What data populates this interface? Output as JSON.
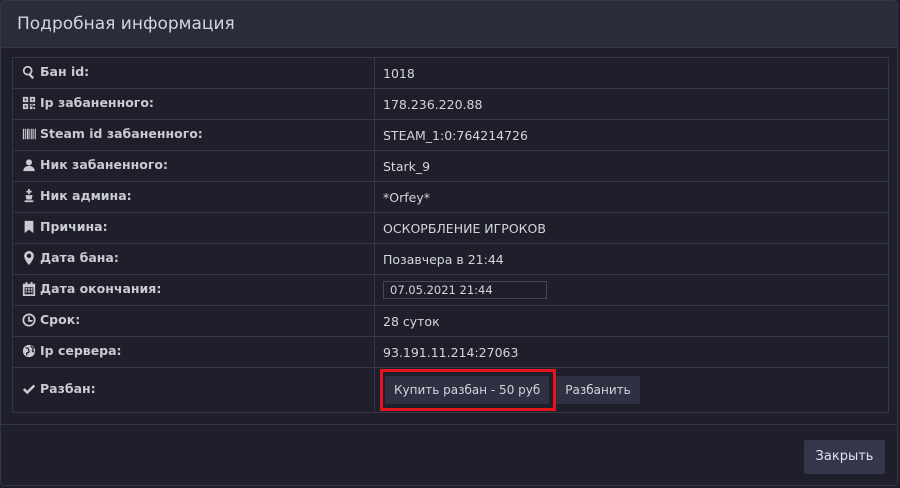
{
  "modal": {
    "title": "Подробная информация"
  },
  "rows": [
    {
      "label": "Бан id:",
      "value": "1018",
      "icon": "search-icon"
    },
    {
      "label": "Ip забаненного:",
      "value": "178.236.220.88",
      "icon": "qr-code-icon"
    },
    {
      "label": "Steam id забаненного:",
      "value": "STEAM_1:0:764214726",
      "icon": "barcode-icon"
    },
    {
      "label": "Ник забаненного:",
      "value": "Stark_9",
      "icon": "user-icon"
    },
    {
      "label": "Ник админа:",
      "value": "*Orfey*",
      "icon": "chess-king-icon"
    },
    {
      "label": "Причина:",
      "value": "ОСКОРБЛЕНИЕ ИГРОКОВ",
      "icon": "bookmark-icon"
    },
    {
      "label": "Дата бана:",
      "value": "Позавчера в 21:44",
      "icon": "map-marker-icon"
    },
    {
      "label": "Дата окончания:",
      "value": "07.05.2021 21:44",
      "icon": "calendar-icon"
    },
    {
      "label": "Срок:",
      "value": "28 суток",
      "icon": "clock-icon"
    },
    {
      "label": "Ip сервера:",
      "value": "93.191.11.214:27063",
      "icon": "globe-icon"
    },
    {
      "label": "Разбан:",
      "icon": "checkmark-icon"
    }
  ],
  "unban": {
    "buy_label": "Купить разбан - 50 руб",
    "unban_label": "Разбанить"
  },
  "footer": {
    "close_label": "Закрыть"
  },
  "colors": {
    "highlight": "#e4141c",
    "background": "#1e1f2b",
    "header": "#2a2b3b"
  }
}
